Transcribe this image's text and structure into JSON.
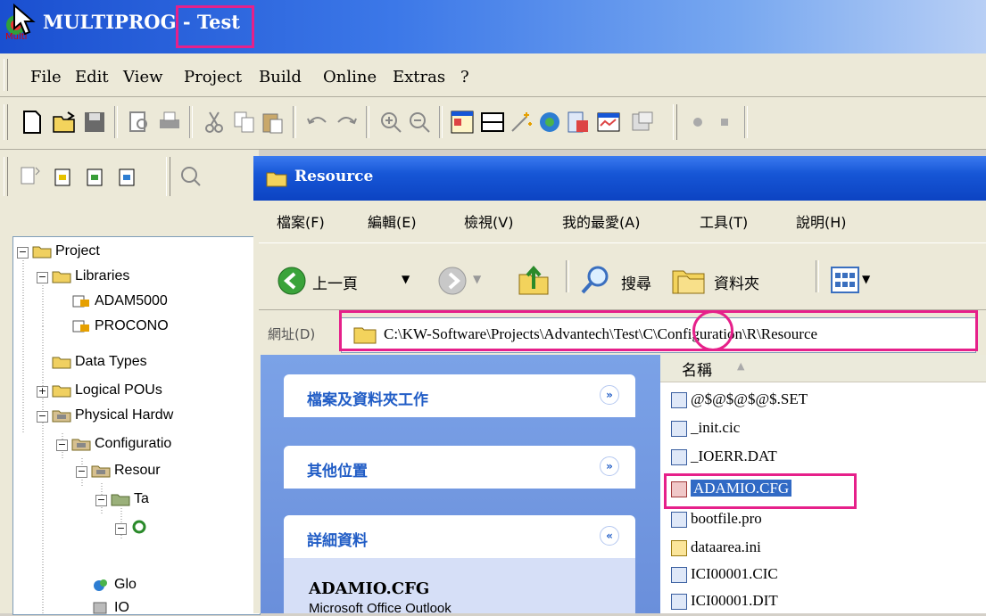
{
  "app": {
    "title_app": "MULTIPROG",
    "title_sep": " - ",
    "title_doc": "Test",
    "logo_text": "Multi"
  },
  "menubar": {
    "items": [
      {
        "label": "File"
      },
      {
        "label": "Edit"
      },
      {
        "label": "View"
      },
      {
        "label": "Project"
      },
      {
        "label": "Build"
      },
      {
        "label": "Online"
      },
      {
        "label": "Extras"
      },
      {
        "label": "?"
      }
    ]
  },
  "toolbar1": {
    "icons": [
      "new-file-icon",
      "open-folder-icon",
      "save-icon",
      "print-preview-icon",
      "print-icon",
      "cut-icon",
      "copy-icon",
      "paste-icon",
      "undo-icon",
      "redo-icon",
      "zoom-in-icon",
      "zoom-out-icon",
      "window-layout-icon",
      "message-window-icon",
      "magic-wand-icon",
      "network-icon",
      "cross-reference-icon",
      "watch-window-icon",
      "library-icon",
      "record-icon",
      "stop-icon"
    ]
  },
  "tree": {
    "items": [
      {
        "label": "Project"
      },
      {
        "label": "Libraries"
      },
      {
        "label": "ADAM5000"
      },
      {
        "label": "PROCONO"
      },
      {
        "label": "Data Types"
      },
      {
        "label": "Logical POUs"
      },
      {
        "label": "Physical Hardw"
      },
      {
        "label": "Configuratio"
      },
      {
        "label": "Resour"
      },
      {
        "label": "Ta"
      },
      {
        "label": ""
      },
      {
        "label": "Glo"
      },
      {
        "label": "IO"
      }
    ]
  },
  "explorer": {
    "title": "Resource",
    "menu": [
      "檔案(F)",
      "編輯(E)",
      "檢視(V)",
      "我的最愛(A)",
      "工具(T)",
      "說明(H)"
    ],
    "toolbar": {
      "back_label": "上一頁",
      "search_label": "搜尋",
      "folders_label": "資料夾"
    },
    "address": {
      "label": "網址(D)",
      "value": "C:\\KW-Software\\Projects\\Advantech\\Test\\C\\Configuration\\R\\Resource"
    },
    "taskpane": {
      "file_folder_tasks": "檔案及資料夾工作",
      "other_places": "其他位置",
      "details": "詳細資料",
      "detail_name": "ADAMIO.CFG",
      "detail_type": "Microsoft Office Outlook"
    },
    "filelist": {
      "column_name": "名稱",
      "files": [
        {
          "name": "@$@$@$@$.SET"
        },
        {
          "name": "_init.cic"
        },
        {
          "name": "_IOERR.DAT"
        },
        {
          "name": "ADAMIO.CFG",
          "selected": true
        },
        {
          "name": "bootfile.pro"
        },
        {
          "name": "dataarea.ini"
        },
        {
          "name": "ICI00001.CIC"
        },
        {
          "name": "ICI00001.DIT"
        }
      ]
    }
  },
  "colors": {
    "highlight": "#e6208a",
    "title_blue": "#1656d6",
    "task_blue": "#215dc6",
    "selection": "#316ac5"
  }
}
